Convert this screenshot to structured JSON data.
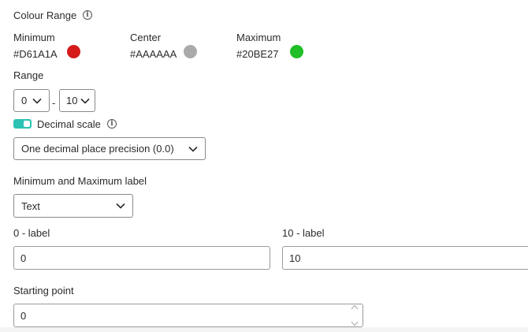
{
  "colour_range": {
    "title": "Colour Range",
    "minimum": {
      "label": "Minimum",
      "hex": "#D61A1A",
      "color": "#D61A1A"
    },
    "center": {
      "label": "Center",
      "hex": "#AAAAAA",
      "color": "#AAAAAA"
    },
    "maximum": {
      "label": "Maximum",
      "hex": "#20BE27",
      "color": "#20BE27"
    }
  },
  "range": {
    "label": "Range",
    "from_value": "0",
    "separator": "-",
    "to_value": "10"
  },
  "decimal_scale": {
    "label": "Decimal scale",
    "enabled": true,
    "precision_value": "One decimal place precision (0.0)"
  },
  "min_max_label": {
    "label": "Minimum and Maximum label",
    "type_value": "Text"
  },
  "low_label": {
    "label": "0 - label",
    "value": "0"
  },
  "high_label": {
    "label": "10 - label",
    "value": "10"
  },
  "starting_point": {
    "label": "Starting point",
    "value": "0"
  },
  "colors": {
    "toggle_accent": "#2CC3B5"
  }
}
